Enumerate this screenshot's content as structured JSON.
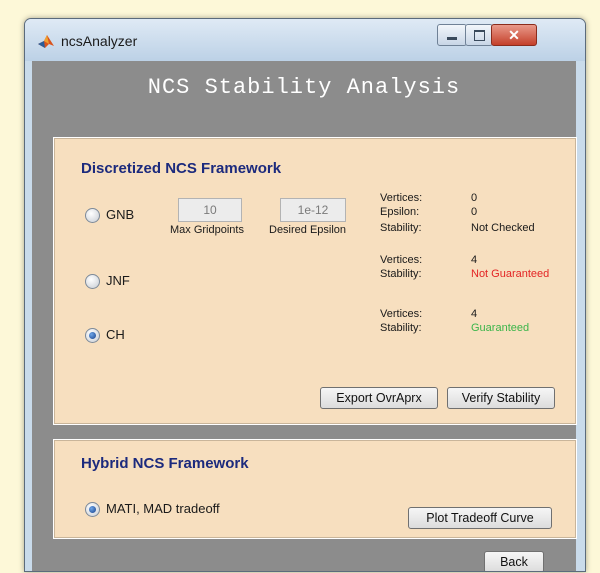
{
  "window": {
    "title": "ncsAnalyzer"
  },
  "app_title": "NCS Stability Analysis",
  "discretized": {
    "title": "Discretized NCS Framework",
    "options": [
      {
        "label": "GNB",
        "selected": false
      },
      {
        "label": "JNF",
        "selected": false
      },
      {
        "label": "CH",
        "selected": true
      }
    ],
    "max_gridpoints": {
      "value": "10",
      "caption": "Max Gridpoints"
    },
    "desired_epsilon": {
      "value": "1e-12",
      "caption": "Desired Epsilon"
    },
    "gnb_info": {
      "vertices_label": "Vertices:",
      "vertices_value": "0",
      "epsilon_label": "Epsilon:",
      "epsilon_value": "0",
      "stability_label": "Stability:",
      "stability_value": "Not Checked"
    },
    "jnf_info": {
      "vertices_label": "Vertices:",
      "vertices_value": "4",
      "stability_label": "Stability:",
      "stability_value": "Not Guaranteed"
    },
    "ch_info": {
      "vertices_label": "Vertices:",
      "vertices_value": "4",
      "stability_label": "Stability:",
      "stability_value": "Guaranteed"
    },
    "export_label": "Export OvrAprx",
    "verify_label": "Verify Stability"
  },
  "hybrid": {
    "title": "Hybrid NCS Framework",
    "option": {
      "label": "MATI, MAD tradeoff",
      "selected": true
    },
    "plot_label": "Plot Tradeoff Curve"
  },
  "back_label": "Back",
  "colors": {
    "not_guaranteed": "#e32424",
    "guaranteed": "#3bb54a",
    "panel_title": "#1c2a7d"
  },
  "icons": [
    "matlab-logo-icon",
    "minimize-icon",
    "maximize-icon",
    "close-icon",
    "radio-icon"
  ]
}
